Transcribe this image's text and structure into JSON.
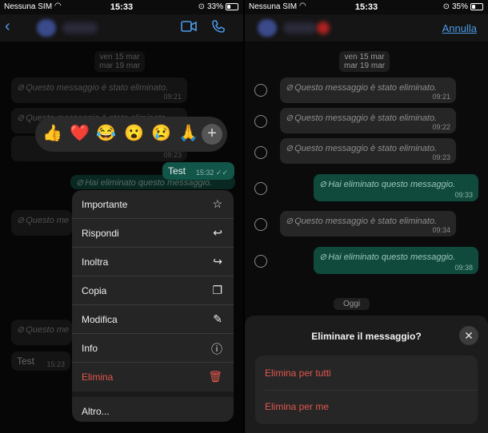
{
  "left": {
    "status": {
      "carrier": "Nessuna SIM",
      "time": "15:33",
      "battery": "33%",
      "battery_level": 0.33
    },
    "date_pill": [
      "ven 15 mar",
      "mar 19 mar"
    ],
    "deleted_text": "Questo messaggio è stato eliminato.",
    "deleted_short": "Questo me",
    "times": {
      "m1": "09:21",
      "m3": "09:23",
      "test_out": "15:32",
      "test_in": "15:23"
    },
    "out_deleted_text": "Hai eliminato questo messaggio.",
    "test_text": "Test",
    "reactions": [
      "👍",
      "❤️",
      "😂",
      "😮",
      "😢",
      "🙏"
    ],
    "plus_label": "+",
    "menu": {
      "importante": "Importante",
      "rispondi": "Rispondi",
      "inoltra": "Inoltra",
      "copia": "Copia",
      "modifica": "Modifica",
      "info": "Info",
      "elimina": "Elimina",
      "altro": "Altro..."
    }
  },
  "right": {
    "status": {
      "carrier": "Nessuna SIM",
      "time": "15:33",
      "battery": "35%",
      "battery_level": 0.35
    },
    "annulla": "Annulla",
    "date_pill": [
      "ven 15 mar",
      "mar 19 mar"
    ],
    "messages": [
      {
        "text": "Questo messaggio è stato eliminato.",
        "time": "09:21"
      },
      {
        "text": "Questo messaggio è stato eliminato.",
        "time": "09:22"
      },
      {
        "text": "Questo messaggio è stato eliminato.",
        "time": "09:23"
      },
      {
        "text": "Hai eliminato questo messaggio.",
        "time": "09:33"
      },
      {
        "text": "Questo messaggio è stato eliminato.",
        "time": "09:34"
      },
      {
        "text": "Hai eliminato questo messaggio.",
        "time": "09:38"
      }
    ],
    "oggi": "Oggi",
    "sheet": {
      "title": "Eliminare il messaggio?",
      "close": "✕",
      "elimina_tutti": "Elimina per tutti",
      "elimina_me": "Elimina per me"
    }
  }
}
